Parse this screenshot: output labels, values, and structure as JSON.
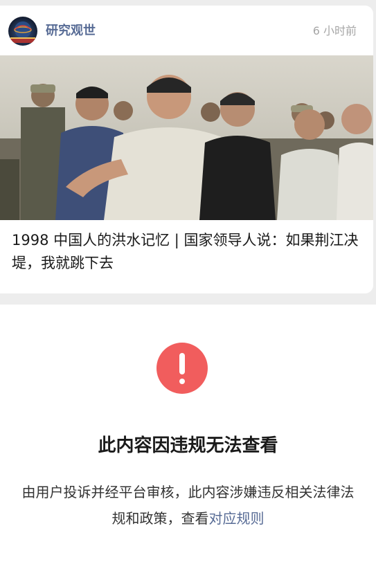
{
  "feed_card": {
    "source_name": "研究观世",
    "time_ago": "6 小时前",
    "title": "1998 中国人的洪水记忆 | 国家领导人说：如果荆江决堤，我就跳下去"
  },
  "blocked_notice": {
    "icon": "exclamation-icon",
    "title": "此内容因违规无法查看",
    "description": "由用户投诉并经平台审核，此内容涉嫌违反相关法律法规和政策，查看",
    "link_text": "对应规则"
  },
  "colors": {
    "link": "#576b95",
    "warning": "#f15d5d",
    "band_background": "#ededed",
    "time_text": "#a6a6a6"
  }
}
